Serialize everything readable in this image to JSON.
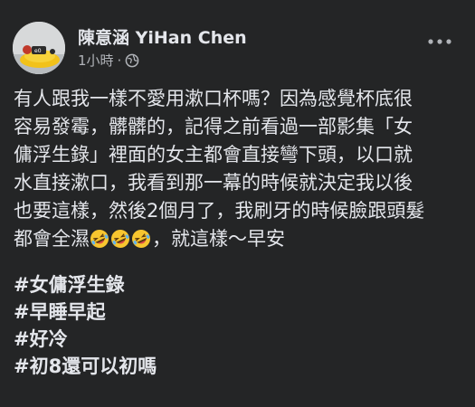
{
  "post": {
    "author": "陳意涵 YiHan Chen",
    "timestamp": "1小時",
    "separator": "·",
    "privacy_icon": "globe-icon",
    "more_icon": "more-options-icon",
    "avatar_icon": "profile-avatar",
    "body_lines": [
      "有人跟我一樣不愛用漱口杯嗎？因為感覺杯底很",
      "容易發霉，髒髒的，記得之前看過一部影集「女",
      "傭浮生錄」裡面的女主都會直接彎下頭，以口就",
      "水直接漱口，我看到那一幕的時候就決定我以後",
      "也要這樣，然後2個月了，我刷牙的時候臉跟頭髮"
    ],
    "last_line_prefix": "都會全濕",
    "emoji_name": "rolling-on-floor-laughing-emoji",
    "last_line_suffix": "，就這樣～早安",
    "hashtags": [
      "#女傭浮生錄",
      "#早睡早起",
      "#好冷",
      "#初8還可以初嗎"
    ]
  }
}
